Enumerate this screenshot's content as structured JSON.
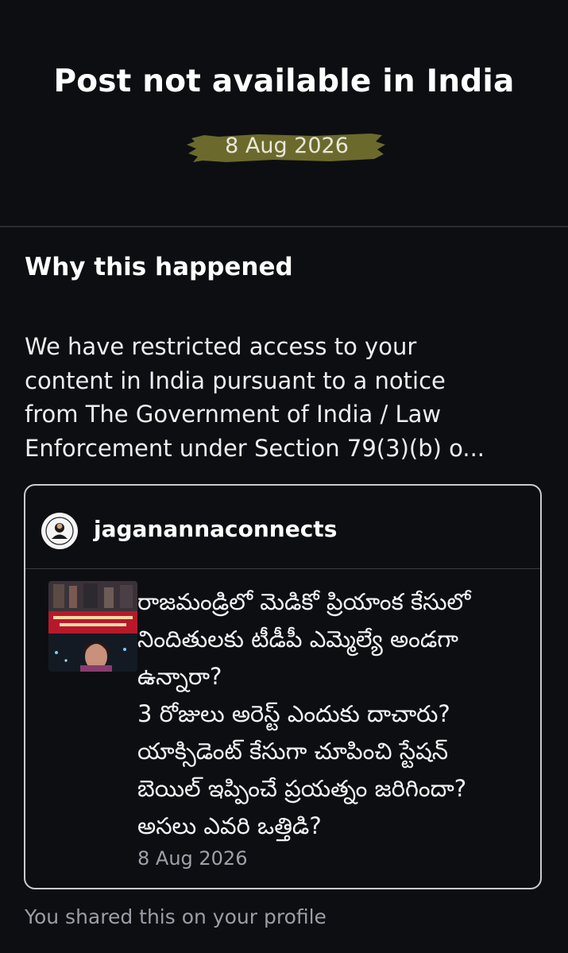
{
  "header": {
    "title": "Post not available in India",
    "date": "8 Aug 2026",
    "date_highlight_color": "#6b6a2c"
  },
  "why": {
    "heading": "Why this happened",
    "body_lines": [
      "We have restricted access to your",
      "content in India pursuant to a notice",
      "from The Government of India / Law",
      "Enforcement under Section 79(3)(b) o..."
    ]
  },
  "card": {
    "username": "jaganannaconnects",
    "avatar_icon": "profile-logo-icon",
    "thumbnail_icon": "news-thumbnail-image",
    "post_lines": [
      "రాజమండ్రిలో మెడికో ప్రియాంక కేసులో",
      "నిందితులకు టీడీపీ ఎమ్మెల్యే అండగా",
      "ఉన్నారా?",
      "3 రోజులు అరెస్ట్ ఎందుకు దాచారు?",
      "యాక్సిడెంట్ కేసుగా చూపించి స్టేషన్",
      "బెయిల్ ఇప్పించే ప్రయత్నం జరిగిందా?",
      "అసలు ఎవరి ఒత్తిడి?"
    ],
    "post_date": "8 Aug 2026"
  },
  "footer": {
    "note": "You shared this on your profile"
  }
}
